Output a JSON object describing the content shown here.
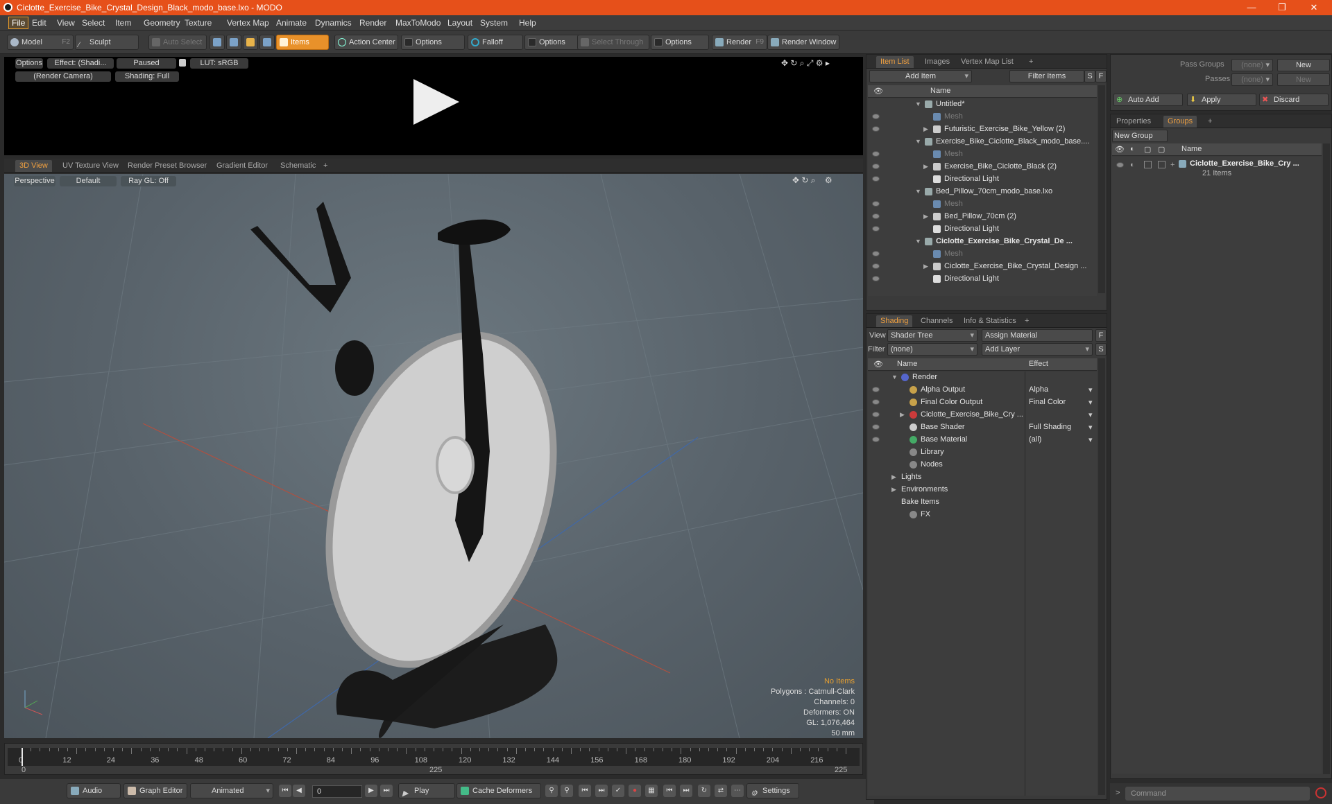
{
  "window": {
    "title": "Ciclotte_Exercise_Bike_Crystal_Design_Black_modo_base.lxo - MODO"
  },
  "menu": [
    "File",
    "Edit",
    "View",
    "Select",
    "Item",
    "Geometry",
    "Texture",
    "Vertex Map",
    "Animate",
    "Dynamics",
    "Render",
    "MaxToModo",
    "Layout",
    "System",
    "Help"
  ],
  "toolbar": {
    "model": "Model",
    "model_key": "F2",
    "sculpt": "Sculpt",
    "auto_select": "Auto Select",
    "items": "Items",
    "action_center": "Action Center",
    "options1": "Options",
    "falloff": "Falloff",
    "options2": "Options",
    "select_through": "Select Through",
    "options3": "Options",
    "render": "Render",
    "render_key": "F9",
    "render_window": "Render Window"
  },
  "preview": {
    "options": "Options",
    "effect": "Effect: (Shadi...",
    "paused": "Paused",
    "lut": "LUT: sRGB",
    "camera": "(Render Camera)",
    "shading": "Shading: Full"
  },
  "view_tabs": [
    "3D View",
    "UV Texture View",
    "Render Preset Browser",
    "Gradient Editor",
    "Schematic",
    "+"
  ],
  "viewport": {
    "projection": "Perspective",
    "style": "Default",
    "raygl": "Ray GL: Off"
  },
  "hud": {
    "no_items": "No Items",
    "polygons": "Polygons : Catmull-Clark",
    "channels": "Channels: 0",
    "deformers": "Deformers: ON",
    "gl": "GL: 1,076,464",
    "lens": "50 mm"
  },
  "timeline": {
    "ticks": [
      "0",
      "12",
      "24",
      "36",
      "48",
      "60",
      "72",
      "84",
      "96",
      "108",
      "120",
      "132",
      "144",
      "156",
      "168",
      "180",
      "192",
      "204",
      "216"
    ],
    "start": "0",
    "mid": "225",
    "end": "225"
  },
  "bottom": {
    "audio": "Audio",
    "graph_editor": "Graph Editor",
    "animated": "Animated",
    "frame": "0",
    "play": "Play",
    "cache": "Cache Deformers",
    "settings": "Settings"
  },
  "item_list": {
    "tabs": [
      "Item List",
      "Images",
      "Vertex Map List",
      "+"
    ],
    "add_item": "Add Item",
    "filter": "Filter Items",
    "s": "S",
    "f": "F",
    "col_name": "Name",
    "rows": [
      {
        "text": "Untitled*",
        "indent": 0,
        "type": "scene",
        "exp": "▼",
        "style": ""
      },
      {
        "text": "Mesh",
        "indent": 1,
        "type": "mesh",
        "exp": "",
        "style": "grey"
      },
      {
        "text": "Futuristic_Exercise_Bike_Yellow (2)",
        "indent": 1,
        "type": "group",
        "exp": "▶",
        "style": ""
      },
      {
        "text": "Exercise_Bike_Ciclotte_Black_modo_base....",
        "indent": 0,
        "type": "scene",
        "exp": "▼",
        "style": ""
      },
      {
        "text": "Mesh",
        "indent": 1,
        "type": "mesh",
        "exp": "",
        "style": "grey"
      },
      {
        "text": "Exercise_Bike_Ciclotte_Black (2)",
        "indent": 1,
        "type": "group",
        "exp": "▶",
        "style": ""
      },
      {
        "text": "Directional Light",
        "indent": 1,
        "type": "light",
        "exp": "",
        "style": ""
      },
      {
        "text": "Bed_Pillow_70cm_modo_base.lxo",
        "indent": 0,
        "type": "scene",
        "exp": "▼",
        "style": ""
      },
      {
        "text": "Mesh",
        "indent": 1,
        "type": "mesh",
        "exp": "",
        "style": "grey"
      },
      {
        "text": "Bed_Pillow_70cm (2)",
        "indent": 1,
        "type": "group",
        "exp": "▶",
        "style": ""
      },
      {
        "text": "Directional Light",
        "indent": 1,
        "type": "light",
        "exp": "",
        "style": ""
      },
      {
        "text": "Ciclotte_Exercise_Bike_Crystal_De ...",
        "indent": 0,
        "type": "scene",
        "exp": "▼",
        "style": "b"
      },
      {
        "text": "Mesh",
        "indent": 1,
        "type": "mesh",
        "exp": "",
        "style": "grey"
      },
      {
        "text": "Ciclotte_Exercise_Bike_Crystal_Design ...",
        "indent": 1,
        "type": "group",
        "exp": "▶",
        "style": ""
      },
      {
        "text": "Directional Light",
        "indent": 1,
        "type": "light",
        "exp": "",
        "style": ""
      }
    ]
  },
  "shading": {
    "tabs": [
      "Shading",
      "Channels",
      "Info & Statistics",
      "+"
    ],
    "view_label": "View",
    "view_value": "Shader Tree",
    "assign": "Assign Material",
    "f": "F",
    "filter_label": "Filter",
    "filter_value": "(none)",
    "add_layer": "Add Layer",
    "s": "S",
    "col_name": "Name",
    "col_effect": "Effect",
    "rows": [
      {
        "text": "Render",
        "effect": "",
        "indent": 0,
        "exp": "▼",
        "color": "#5566cc",
        "eye": false
      },
      {
        "text": "Alpha Output",
        "effect": "Alpha",
        "indent": 1,
        "exp": "",
        "color": "#c8a24a",
        "eye": true
      },
      {
        "text": "Final Color Output",
        "effect": "Final Color",
        "indent": 1,
        "exp": "",
        "color": "#c8a24a",
        "eye": true
      },
      {
        "text": "Ciclotte_Exercise_Bike_Cry ...",
        "effect": "",
        "indent": 1,
        "exp": "▶",
        "color": "#cc3b3b",
        "eye": true
      },
      {
        "text": "Base Shader",
        "effect": "Full Shading",
        "indent": 1,
        "exp": "",
        "color": "#cccccc",
        "eye": true
      },
      {
        "text": "Base Material",
        "effect": "(all)",
        "indent": 1,
        "exp": "",
        "color": "#44aa66",
        "eye": true
      },
      {
        "text": "Library",
        "effect": "",
        "indent": 1,
        "exp": "",
        "color": "#888888",
        "eye": false
      },
      {
        "text": "Nodes",
        "effect": "",
        "indent": 1,
        "exp": "",
        "color": "#888888",
        "eye": false
      },
      {
        "text": "Lights",
        "effect": "",
        "indent": 0,
        "exp": "▶",
        "color": "",
        "eye": false
      },
      {
        "text": "Environments",
        "effect": "",
        "indent": 0,
        "exp": "▶",
        "color": "",
        "eye": false
      },
      {
        "text": "Bake Items",
        "effect": "",
        "indent": 0,
        "exp": "",
        "color": "",
        "eye": false
      },
      {
        "text": "FX",
        "effect": "",
        "indent": 1,
        "exp": "",
        "color": "#888888",
        "eye": false
      }
    ]
  },
  "right": {
    "pass_groups": "Pass Groups",
    "pass_groups_val": "(none)",
    "new": "New",
    "passes": "Passes",
    "passes_val": "(none)",
    "new2": "New",
    "auto_add": "Auto Add",
    "apply": "Apply",
    "discard": "Discard",
    "tabs": [
      "Properties",
      "Groups",
      "+"
    ],
    "new_group": "New Group",
    "col_name": "Name",
    "group_name": "Ciclotte_Exercise_Bike_Cry ...",
    "group_count": "21 Items",
    "command": "Command"
  }
}
